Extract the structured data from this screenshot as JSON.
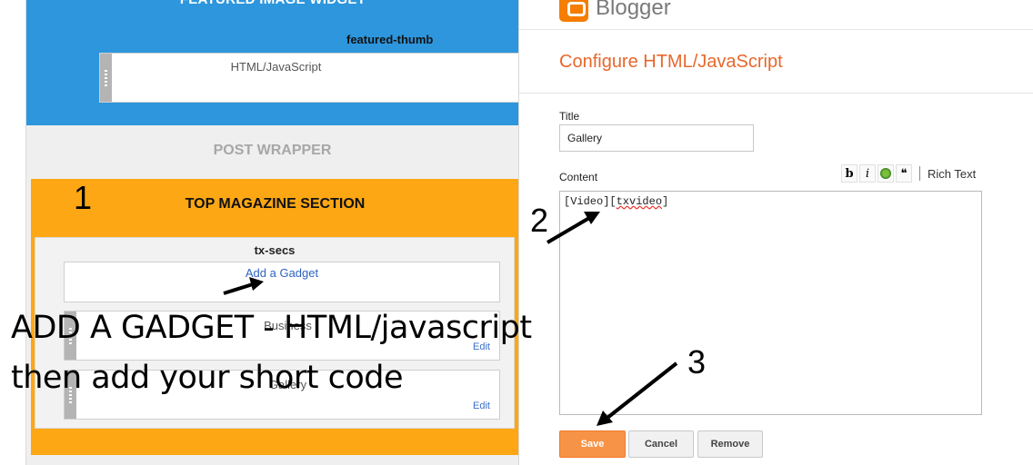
{
  "layout": {
    "featured_section": {
      "title": "FEATURED IMAGE WIDGET",
      "section_name": "featured-thumb",
      "gadget_title": "HTML/JavaScript"
    },
    "post_wrapper_label": "POST WRAPPER",
    "magazine": {
      "number": "1",
      "title": "TOP MAGAZINE SECTION",
      "section_name": "tx-secs",
      "add_gadget": "Add a Gadget",
      "gadgets": [
        {
          "title": "Business",
          "edit": "Edit"
        },
        {
          "title": "Gallery",
          "edit": "Edit"
        }
      ]
    }
  },
  "annotation": {
    "line1": "ADD A GADGET - HTML/javascript",
    "line2": "then add your short code"
  },
  "dialog": {
    "brand": "Blogger",
    "title": "Configure HTML/JavaScript",
    "title_label": "Title",
    "title_value": "Gallery",
    "content_label": "Content",
    "content_value_plain": "[Video][",
    "content_value_misspelled": "txvideo",
    "content_value_end": "]",
    "toolbar": {
      "bold": "b",
      "italic": "i",
      "quote": "❝",
      "rich_text": "Rich Text"
    },
    "buttons": {
      "save": "Save",
      "cancel": "Cancel",
      "remove": "Remove"
    },
    "step_labels": {
      "two": "2",
      "three": "3"
    },
    "colors": {
      "accent": "#e8672c",
      "save_button": "#f79346",
      "featured_bg": "#2d96dd",
      "magazine_bg": "#fca713"
    }
  }
}
